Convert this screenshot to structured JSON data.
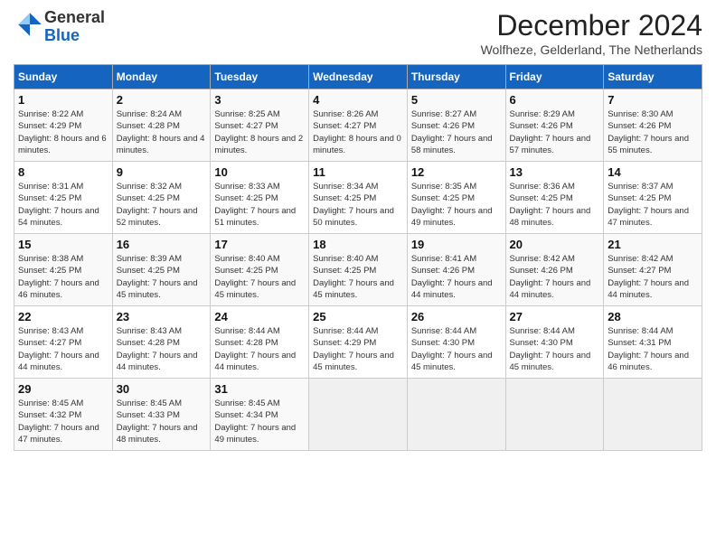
{
  "logo": {
    "text_general": "General",
    "text_blue": "Blue"
  },
  "title": {
    "month_year": "December 2024",
    "location": "Wolfheze, Gelderland, The Netherlands"
  },
  "weekdays": [
    "Sunday",
    "Monday",
    "Tuesday",
    "Wednesday",
    "Thursday",
    "Friday",
    "Saturday"
  ],
  "weeks": [
    [
      {
        "day": "1",
        "sunrise": "Sunrise: 8:22 AM",
        "sunset": "Sunset: 4:29 PM",
        "daylight": "Daylight: 8 hours and 6 minutes."
      },
      {
        "day": "2",
        "sunrise": "Sunrise: 8:24 AM",
        "sunset": "Sunset: 4:28 PM",
        "daylight": "Daylight: 8 hours and 4 minutes."
      },
      {
        "day": "3",
        "sunrise": "Sunrise: 8:25 AM",
        "sunset": "Sunset: 4:27 PM",
        "daylight": "Daylight: 8 hours and 2 minutes."
      },
      {
        "day": "4",
        "sunrise": "Sunrise: 8:26 AM",
        "sunset": "Sunset: 4:27 PM",
        "daylight": "Daylight: 8 hours and 0 minutes."
      },
      {
        "day": "5",
        "sunrise": "Sunrise: 8:27 AM",
        "sunset": "Sunset: 4:26 PM",
        "daylight": "Daylight: 7 hours and 58 minutes."
      },
      {
        "day": "6",
        "sunrise": "Sunrise: 8:29 AM",
        "sunset": "Sunset: 4:26 PM",
        "daylight": "Daylight: 7 hours and 57 minutes."
      },
      {
        "day": "7",
        "sunrise": "Sunrise: 8:30 AM",
        "sunset": "Sunset: 4:26 PM",
        "daylight": "Daylight: 7 hours and 55 minutes."
      }
    ],
    [
      {
        "day": "8",
        "sunrise": "Sunrise: 8:31 AM",
        "sunset": "Sunset: 4:25 PM",
        "daylight": "Daylight: 7 hours and 54 minutes."
      },
      {
        "day": "9",
        "sunrise": "Sunrise: 8:32 AM",
        "sunset": "Sunset: 4:25 PM",
        "daylight": "Daylight: 7 hours and 52 minutes."
      },
      {
        "day": "10",
        "sunrise": "Sunrise: 8:33 AM",
        "sunset": "Sunset: 4:25 PM",
        "daylight": "Daylight: 7 hours and 51 minutes."
      },
      {
        "day": "11",
        "sunrise": "Sunrise: 8:34 AM",
        "sunset": "Sunset: 4:25 PM",
        "daylight": "Daylight: 7 hours and 50 minutes."
      },
      {
        "day": "12",
        "sunrise": "Sunrise: 8:35 AM",
        "sunset": "Sunset: 4:25 PM",
        "daylight": "Daylight: 7 hours and 49 minutes."
      },
      {
        "day": "13",
        "sunrise": "Sunrise: 8:36 AM",
        "sunset": "Sunset: 4:25 PM",
        "daylight": "Daylight: 7 hours and 48 minutes."
      },
      {
        "day": "14",
        "sunrise": "Sunrise: 8:37 AM",
        "sunset": "Sunset: 4:25 PM",
        "daylight": "Daylight: 7 hours and 47 minutes."
      }
    ],
    [
      {
        "day": "15",
        "sunrise": "Sunrise: 8:38 AM",
        "sunset": "Sunset: 4:25 PM",
        "daylight": "Daylight: 7 hours and 46 minutes."
      },
      {
        "day": "16",
        "sunrise": "Sunrise: 8:39 AM",
        "sunset": "Sunset: 4:25 PM",
        "daylight": "Daylight: 7 hours and 45 minutes."
      },
      {
        "day": "17",
        "sunrise": "Sunrise: 8:40 AM",
        "sunset": "Sunset: 4:25 PM",
        "daylight": "Daylight: 7 hours and 45 minutes."
      },
      {
        "day": "18",
        "sunrise": "Sunrise: 8:40 AM",
        "sunset": "Sunset: 4:25 PM",
        "daylight": "Daylight: 7 hours and 45 minutes."
      },
      {
        "day": "19",
        "sunrise": "Sunrise: 8:41 AM",
        "sunset": "Sunset: 4:26 PM",
        "daylight": "Daylight: 7 hours and 44 minutes."
      },
      {
        "day": "20",
        "sunrise": "Sunrise: 8:42 AM",
        "sunset": "Sunset: 4:26 PM",
        "daylight": "Daylight: 7 hours and 44 minutes."
      },
      {
        "day": "21",
        "sunrise": "Sunrise: 8:42 AM",
        "sunset": "Sunset: 4:27 PM",
        "daylight": "Daylight: 7 hours and 44 minutes."
      }
    ],
    [
      {
        "day": "22",
        "sunrise": "Sunrise: 8:43 AM",
        "sunset": "Sunset: 4:27 PM",
        "daylight": "Daylight: 7 hours and 44 minutes."
      },
      {
        "day": "23",
        "sunrise": "Sunrise: 8:43 AM",
        "sunset": "Sunset: 4:28 PM",
        "daylight": "Daylight: 7 hours and 44 minutes."
      },
      {
        "day": "24",
        "sunrise": "Sunrise: 8:44 AM",
        "sunset": "Sunset: 4:28 PM",
        "daylight": "Daylight: 7 hours and 44 minutes."
      },
      {
        "day": "25",
        "sunrise": "Sunrise: 8:44 AM",
        "sunset": "Sunset: 4:29 PM",
        "daylight": "Daylight: 7 hours and 45 minutes."
      },
      {
        "day": "26",
        "sunrise": "Sunrise: 8:44 AM",
        "sunset": "Sunset: 4:30 PM",
        "daylight": "Daylight: 7 hours and 45 minutes."
      },
      {
        "day": "27",
        "sunrise": "Sunrise: 8:44 AM",
        "sunset": "Sunset: 4:30 PM",
        "daylight": "Daylight: 7 hours and 45 minutes."
      },
      {
        "day": "28",
        "sunrise": "Sunrise: 8:44 AM",
        "sunset": "Sunset: 4:31 PM",
        "daylight": "Daylight: 7 hours and 46 minutes."
      }
    ],
    [
      {
        "day": "29",
        "sunrise": "Sunrise: 8:45 AM",
        "sunset": "Sunset: 4:32 PM",
        "daylight": "Daylight: 7 hours and 47 minutes."
      },
      {
        "day": "30",
        "sunrise": "Sunrise: 8:45 AM",
        "sunset": "Sunset: 4:33 PM",
        "daylight": "Daylight: 7 hours and 48 minutes."
      },
      {
        "day": "31",
        "sunrise": "Sunrise: 8:45 AM",
        "sunset": "Sunset: 4:34 PM",
        "daylight": "Daylight: 7 hours and 49 minutes."
      },
      null,
      null,
      null,
      null
    ]
  ]
}
